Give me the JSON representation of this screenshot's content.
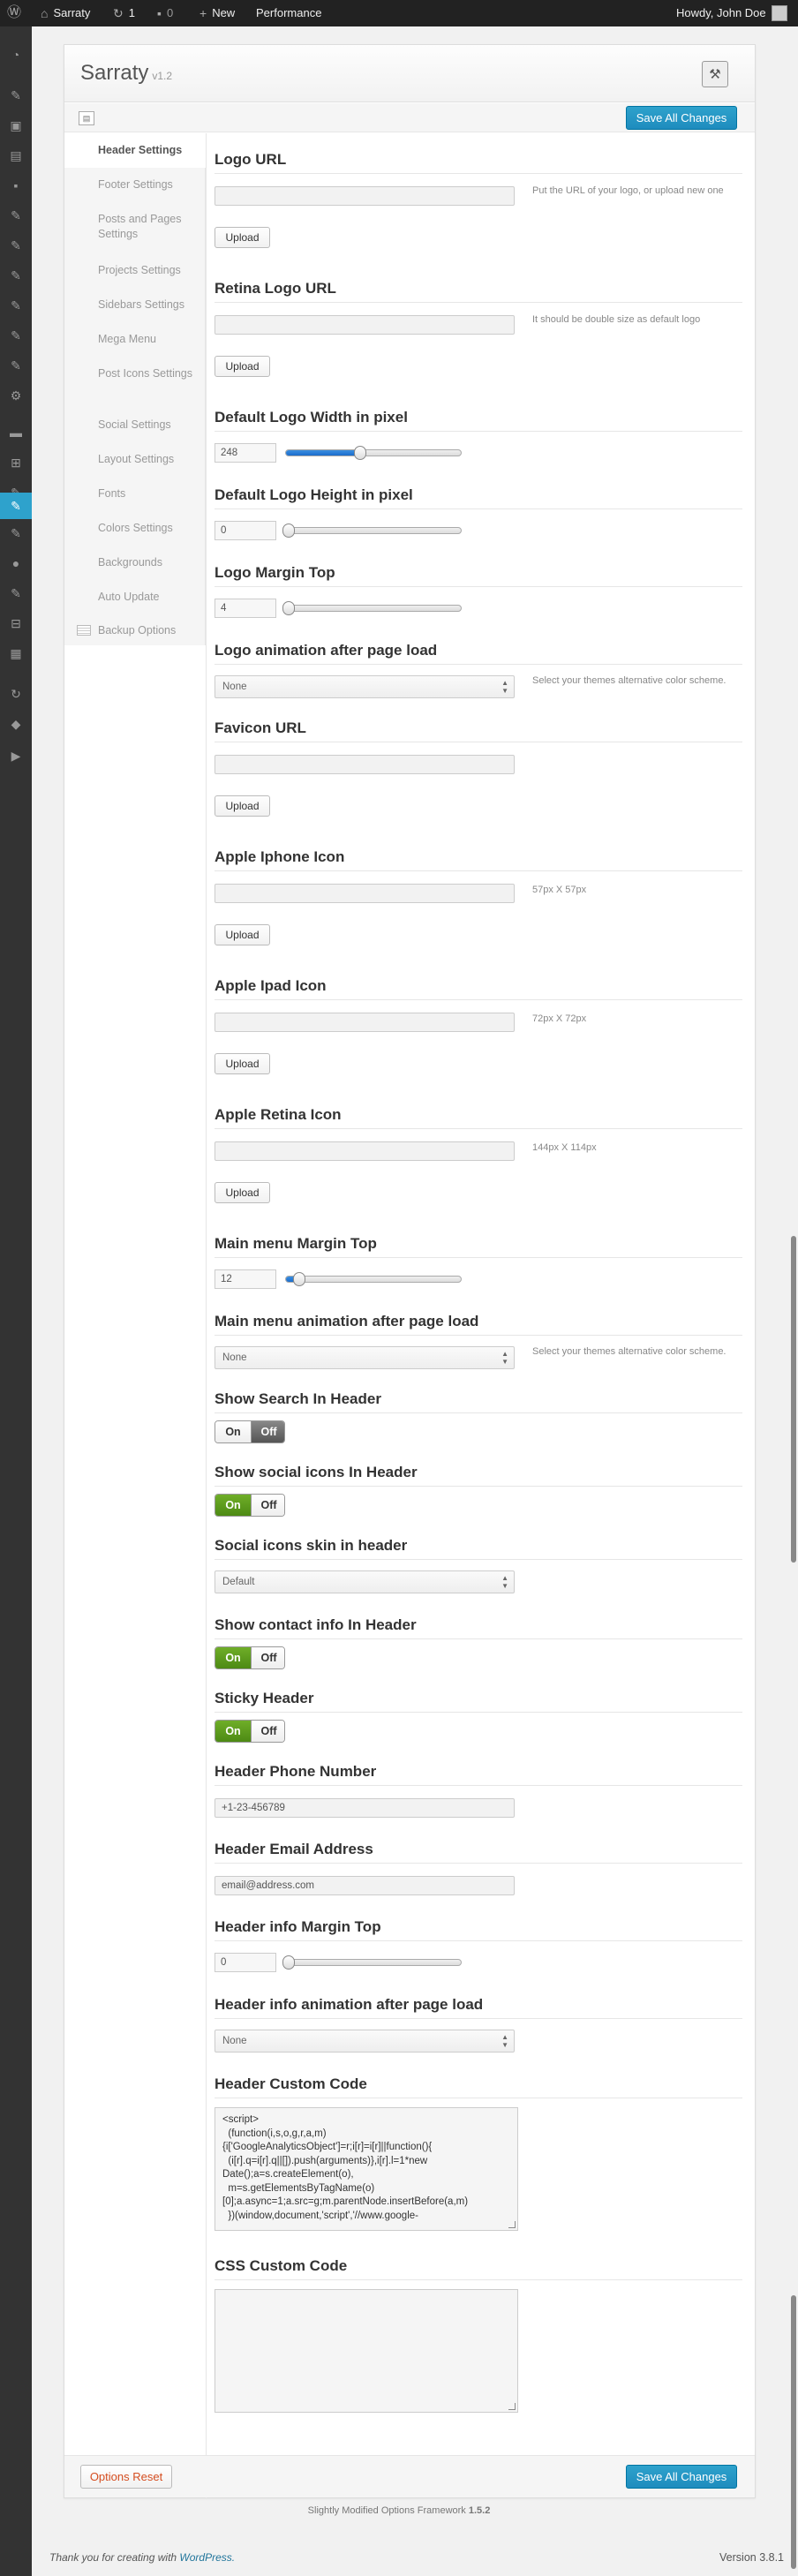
{
  "adminbar": {
    "site_name": "Sarraty",
    "updates_count": "1",
    "comments_count": "0",
    "new_label": "New",
    "performance_label": "Performance",
    "howdy": "Howdy, John Doe"
  },
  "panel": {
    "title": "Sarraty",
    "version": "v1.2",
    "save_all": "Save All Changes",
    "reset": "Options Reset",
    "credit_prefix": "Slightly Modified Options Framework",
    "credit_version": "1.5.2"
  },
  "nav": [
    "Header Settings",
    "Footer Settings",
    "Posts and Pages Settings",
    "Projects Settings",
    "Sidebars Settings",
    "Mega Menu",
    "Post Icons Settings",
    "Social Settings",
    "Layout Settings",
    "Fonts",
    "Colors Settings",
    "Backgrounds",
    "Auto Update",
    "Backup Options"
  ],
  "settings": {
    "logo_url": {
      "title": "Logo URL",
      "value": "",
      "desc": "Put the URL of your logo, or upload new one",
      "button": "Upload"
    },
    "retina_logo": {
      "title": "Retina Logo URL",
      "value": "",
      "desc": "It should be double size as default logo",
      "button": "Upload"
    },
    "logo_width": {
      "title": "Default Logo Width in pixel",
      "value": "248",
      "level": 0.41
    },
    "logo_height": {
      "title": "Default Logo Height in pixel",
      "value": "0",
      "level": 0
    },
    "logo_margin": {
      "title": "Logo Margin Top",
      "value": "4",
      "level": 0
    },
    "logo_anim": {
      "title": "Logo animation after page load",
      "value": "None",
      "desc": "Select your themes alternative color scheme."
    },
    "favicon": {
      "title": "Favicon URL",
      "value": "",
      "button": "Upload"
    },
    "iphone_icon": {
      "title": "Apple Iphone Icon",
      "value": "",
      "desc": "57px X 57px",
      "button": "Upload"
    },
    "ipad_icon": {
      "title": "Apple Ipad Icon",
      "value": "",
      "desc": "72px X 72px",
      "button": "Upload"
    },
    "retina_icon": {
      "title": "Apple Retina Icon",
      "value": "",
      "desc": "144px X 114px",
      "button": "Upload"
    },
    "menu_margin": {
      "title": "Main menu Margin Top",
      "value": "12",
      "level": 0.06
    },
    "menu_anim": {
      "title": "Main menu animation after page load",
      "value": "None",
      "desc": "Select your themes alternative color scheme."
    },
    "show_search": {
      "title": "Show Search In Header",
      "on": "On",
      "off": "Off",
      "state": "off"
    },
    "show_social": {
      "title": "Show social icons In Header",
      "on": "On",
      "off": "Off",
      "state": "on"
    },
    "social_skin": {
      "title": "Social icons skin in header",
      "value": "Default"
    },
    "show_contact": {
      "title": "Show contact info In Header",
      "on": "On",
      "off": "Off",
      "state": "on"
    },
    "sticky": {
      "title": "Sticky Header",
      "on": "On",
      "off": "Off",
      "state": "on"
    },
    "phone": {
      "title": "Header Phone Number",
      "value": "+1-23-456789"
    },
    "email": {
      "title": "Header Email Address",
      "value": "email@address.com"
    },
    "info_margin": {
      "title": "Header info Margin Top",
      "value": "0",
      "level": 0
    },
    "info_anim": {
      "title": "Header info animation after page load",
      "value": "None"
    },
    "custom_code": {
      "title": "Header Custom Code",
      "value": "<script>\n  (function(i,s,o,g,r,a,m){i['GoogleAnalyticsObject']=r;i[r]=i[r]||function(){\n  (i[r].q=i[r].q||[]).push(arguments)},i[r].l=1*new Date();a=s.createElement(o),\n  m=s.getElementsByTagName(o)[0];a.async=1;a.src=g;m.parentNode.insertBefore(a,m)\n  })(window,document,'script','//www.google-"
    },
    "css_code": {
      "title": "CSS Custom Code",
      "value": ""
    }
  },
  "footer": {
    "thanks": "Thank you for creating with",
    "wp_link": "WordPress.",
    "version": "Version 3.8.1"
  }
}
